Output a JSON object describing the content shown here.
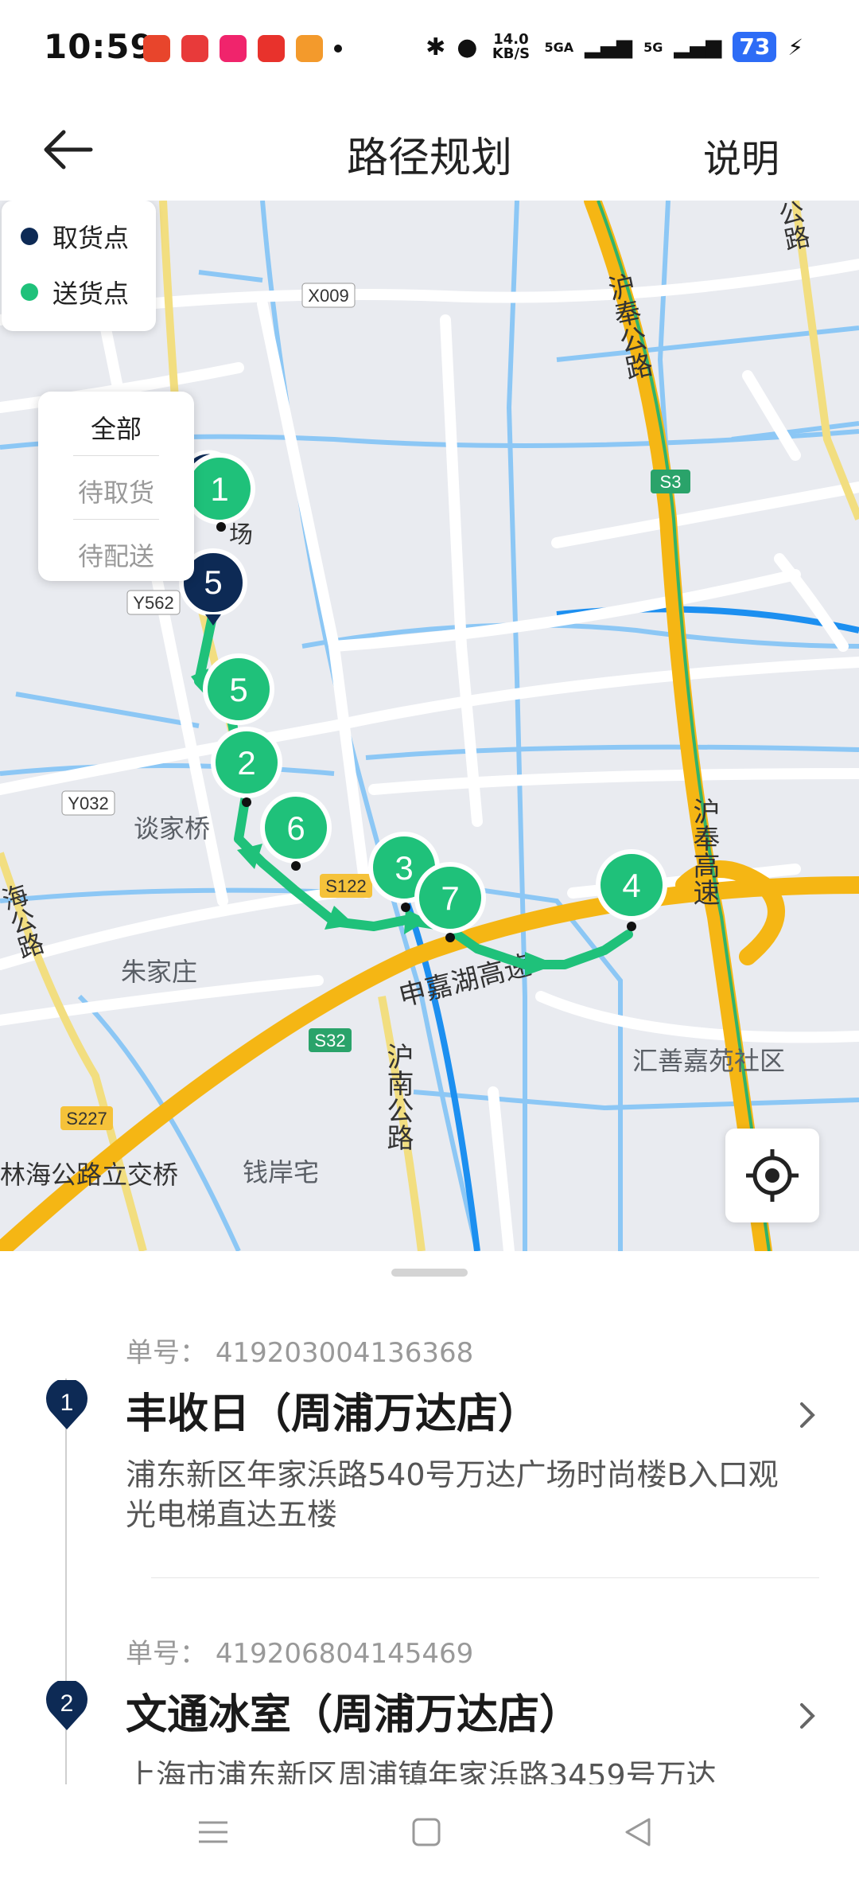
{
  "status_bar": {
    "time": "10:59",
    "network_speed": "14.0 KB/S",
    "signal_1": "5GA",
    "signal_2": "5G",
    "battery": "73"
  },
  "header": {
    "title": "路径规划",
    "help": "说明"
  },
  "legend": {
    "pickup": "取货点",
    "delivery": "送货点"
  },
  "filter": {
    "all": "全部",
    "to_pickup": "待取货",
    "to_deliver": "待配送"
  },
  "map": {
    "labels": {
      "hufeng_road": "沪奉公路",
      "hufeng_highway": "沪奉高速",
      "x009": "X009",
      "s3": "S3",
      "y562": "Y562",
      "y032": "Y032",
      "tanjiaqiao": "谈家桥",
      "s122": "S122",
      "zhujiazhuang": "朱家庄",
      "shenjiahu": "申嘉湖高速",
      "s32": "S32",
      "hunan_road": "沪南公路",
      "huishan": "汇善嘉苑社区",
      "s227": "S227",
      "linhai": "林海公路立交桥",
      "qianan": "钱岸宅",
      "hai_road": "海公路",
      "top_road": "公路",
      "chang": "场"
    },
    "pickup_markers": [
      "5"
    ],
    "delivery_markers": [
      "1",
      "5",
      "2",
      "6",
      "3",
      "7",
      "4"
    ]
  },
  "orders": [
    {
      "seq": "1",
      "order_label": "单号：",
      "order_no": "419203004136368",
      "name": "丰收日（周浦万达店）",
      "address": "浦东新区年家浜路540号万达广场时尚楼B入口观光电梯直达五楼"
    },
    {
      "seq": "2",
      "order_label": "单号：",
      "order_no": "419206804145469",
      "name": "文通冰室（周浦万达店）",
      "address": "上海市浦东新区周浦镇年家浜路3459号万达"
    }
  ],
  "colors": {
    "pickup": "#0d2a55",
    "delivery": "#1fc17a",
    "highway": "#f5b614",
    "water": "#8cc7f5"
  }
}
